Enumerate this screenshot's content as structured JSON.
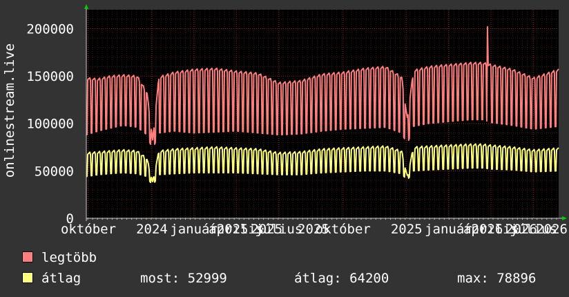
{
  "chart_data": {
    "type": "line",
    "ylabel": "onlinestream.live",
    "ylim": [
      0,
      220000
    ],
    "yticks": [
      0,
      50000,
      100000,
      150000,
      200000
    ],
    "ytick_labels": [
      "0",
      "50000",
      "100000",
      "150000",
      "200000"
    ],
    "xlim": [
      "2024-09-28",
      "2026-08-06"
    ],
    "xtick_dates": [
      "2024-10-01",
      "2024-12-31",
      "2025-03-01",
      "2025-05-01",
      "2025-07-01",
      "2025-10-01",
      "2025-12-31",
      "2026-03-01",
      "2026-05-01",
      "2026-07-01"
    ],
    "xtick_labels": [
      "október",
      "2024",
      "január",
      "2025",
      "április",
      "2025",
      "július",
      "2025",
      "október",
      "2025",
      "január",
      "2026",
      "április",
      "2026",
      "július",
      "2026"
    ],
    "grid": true,
    "colors": {
      "background": "#333333",
      "plot_area": "#000000",
      "grid_major": "#8a2626",
      "grid_minor": "#3a1a1a",
      "axis": "#cccccc",
      "arrow": "#00cc00"
    },
    "series": [
      {
        "name": "legtöbb",
        "color": "#ff7f7f",
        "x": [
          "2024-09-28",
          "2024-10-15",
          "2024-11-01",
          "2024-11-20",
          "2024-12-10",
          "2024-12-24",
          "2025-01-01",
          "2025-01-10",
          "2025-02-01",
          "2025-03-01",
          "2025-04-01",
          "2025-05-01",
          "2025-06-01",
          "2025-07-01",
          "2025-08-01",
          "2025-09-01",
          "2025-10-01",
          "2025-11-01",
          "2025-12-01",
          "2025-12-24",
          "2026-01-01",
          "2026-01-10",
          "2026-02-01",
          "2026-03-01",
          "2026-04-01",
          "2026-04-20",
          "2026-05-01",
          "2026-06-01",
          "2026-07-01",
          "2026-08-06"
        ],
        "weekday": [
          147000,
          146000,
          149000,
          150000,
          149000,
          132000,
          82000,
          148000,
          153000,
          156000,
          157000,
          154000,
          152000,
          142000,
          144000,
          151000,
          153000,
          157000,
          159000,
          148000,
          105000,
          155000,
          159000,
          161000,
          163000,
          163000,
          161000,
          156000,
          147000,
          156000
        ],
        "weekend": [
          88000,
          92000,
          95000,
          98000,
          96000,
          88000,
          72000,
          90000,
          92000,
          90000,
          91000,
          92000,
          90000,
          88000,
          89000,
          92000,
          94000,
          95000,
          96000,
          90000,
          78000,
          97000,
          100000,
          102000,
          104000,
          104000,
          101000,
          98000,
          94000,
          97000
        ],
        "peaks": [
          {
            "x": "2026-04-26",
            "y": 202000
          }
        ]
      },
      {
        "name": "átlag",
        "color": "#ffff7f",
        "x": [
          "2024-09-28",
          "2024-10-15",
          "2024-11-01",
          "2024-11-20",
          "2024-12-10",
          "2024-12-24",
          "2025-01-01",
          "2025-01-10",
          "2025-02-01",
          "2025-03-01",
          "2025-04-01",
          "2025-05-01",
          "2025-06-01",
          "2025-07-01",
          "2025-08-01",
          "2025-09-01",
          "2025-10-01",
          "2025-11-01",
          "2025-12-01",
          "2025-12-24",
          "2026-01-01",
          "2026-01-10",
          "2026-02-01",
          "2026-03-01",
          "2026-04-01",
          "2026-04-20",
          "2026-05-01",
          "2026-06-01",
          "2026-07-01",
          "2026-08-06"
        ],
        "weekday": [
          68000,
          69000,
          70000,
          71000,
          70000,
          62000,
          38000,
          70000,
          72000,
          73000,
          74000,
          73000,
          72000,
          68000,
          69000,
          72000,
          73000,
          74000,
          75000,
          70000,
          44000,
          74000,
          75000,
          76000,
          77000,
          77000,
          76000,
          74000,
          71000,
          73000
        ],
        "weekend": [
          44000,
          46000,
          47000,
          48000,
          47000,
          44000,
          34000,
          46000,
          47000,
          48000,
          48000,
          48000,
          47000,
          46000,
          46000,
          48000,
          49000,
          50000,
          50000,
          47000,
          40000,
          50000,
          51000,
          52000,
          53000,
          53000,
          52000,
          51000,
          49000,
          50000
        ]
      }
    ]
  },
  "legend": {
    "items": [
      {
        "label": "legtöbb",
        "color": "#ff7f7f"
      },
      {
        "label": "átlag",
        "color": "#ffff7f"
      }
    ],
    "stats": {
      "most": "most: 52999",
      "atlag": "átlag: 64200",
      "max": "max: 78896"
    }
  }
}
